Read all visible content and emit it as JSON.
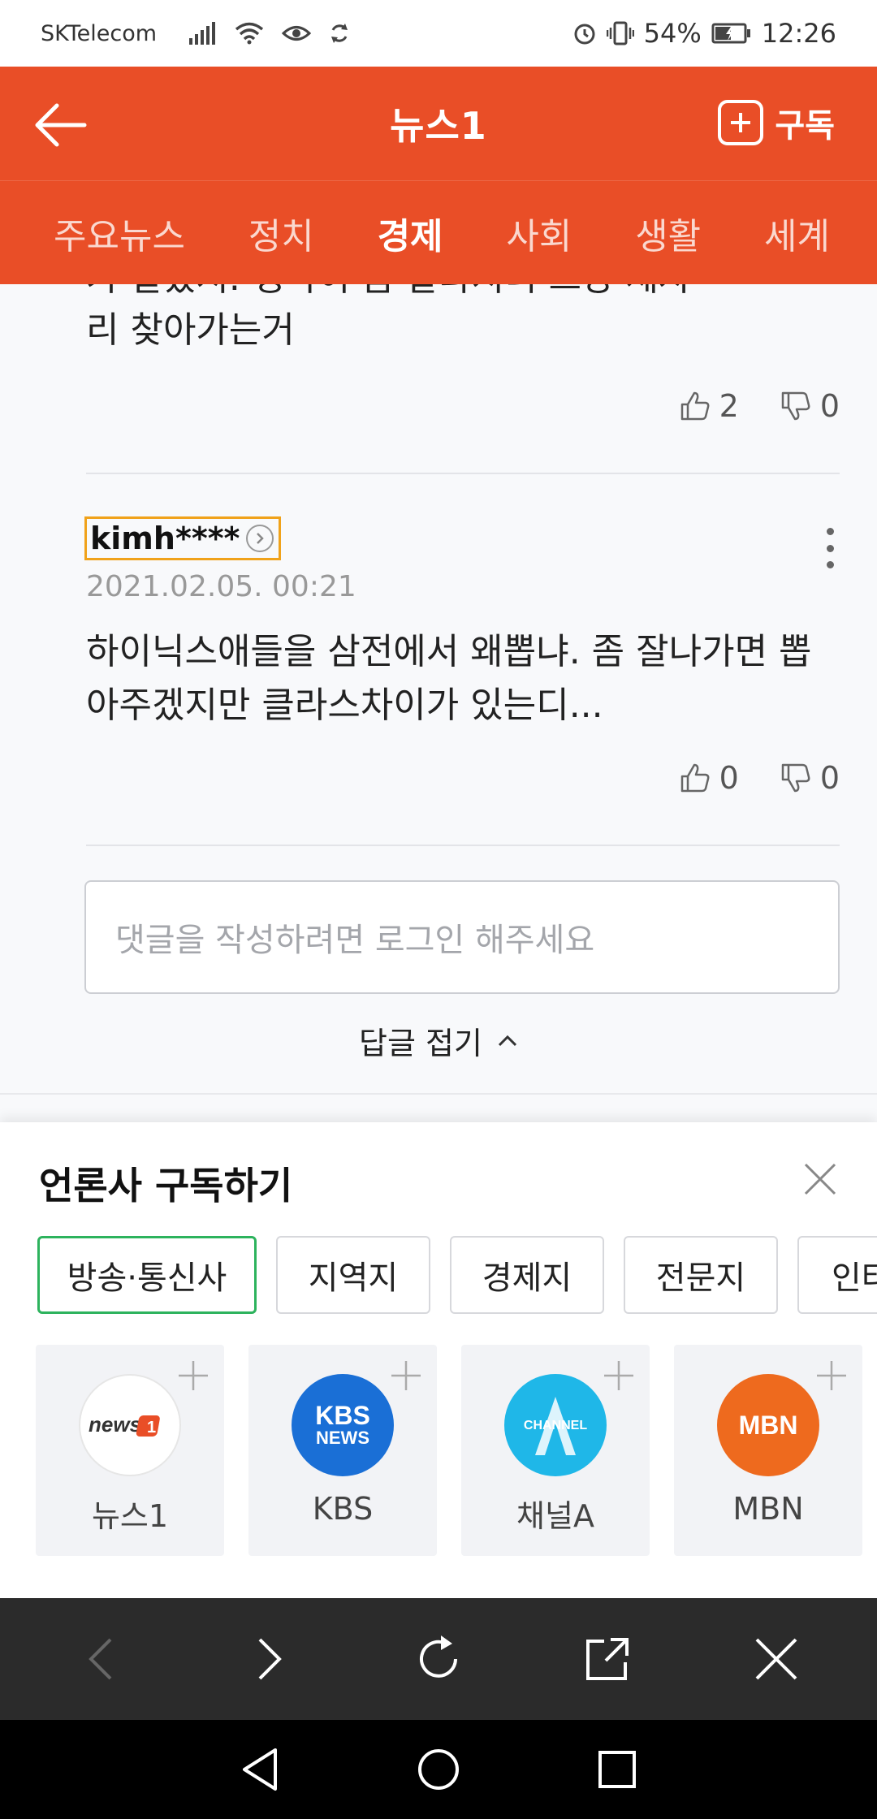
{
  "status_bar": {
    "carrier": "SKTelecom",
    "battery": "54%",
    "time": "12:26"
  },
  "header": {
    "title": "뉴스1",
    "subscribe_label": "구독"
  },
  "tabs": [
    {
      "label": "주요뉴스",
      "active": false
    },
    {
      "label": "정치",
      "active": false
    },
    {
      "label": "경제",
      "active": true
    },
    {
      "label": "사회",
      "active": false
    },
    {
      "label": "생활",
      "active": false
    },
    {
      "label": "세계",
      "active": false
    }
  ],
  "comments": [
    {
      "partial_line": "가 알았지. 생각이 좀 달라지니 그냥 제자",
      "text": "리 찾아가는거",
      "likes": "2",
      "dislikes": "0"
    },
    {
      "author": "kimh****",
      "date": "2021.02.05. 00:21",
      "text": "하이닉스애들을 삼전에서 왜뽑냐. 좀 잘나가면 뽑아주겠지만 클라스차이가 있는디...",
      "likes": "0",
      "dislikes": "0"
    }
  ],
  "comment_input": {
    "placeholder": "댓글을 작성하려면 로그인 해주세요"
  },
  "fold_label": "답글 접기",
  "subscribe_sheet": {
    "title": "언론사 구독하기",
    "categories": [
      {
        "label": "방송·통신사",
        "active": true
      },
      {
        "label": "지역지",
        "active": false
      },
      {
        "label": "경제지",
        "active": false
      },
      {
        "label": "전문지",
        "active": false
      },
      {
        "label": "인터",
        "active": false
      }
    ],
    "press": [
      {
        "name": "뉴스1",
        "logo_text": "news1",
        "logo_bg": "#ffffff",
        "logo_fg": "#e94e27"
      },
      {
        "name": "KBS",
        "logo_text": "KBS NEWS",
        "logo_bg": "#1a6fd6",
        "logo_fg": "#ffffff"
      },
      {
        "name": "채널A",
        "logo_text": "CHANNEL A",
        "logo_bg": "#1fb7e8",
        "logo_fg": "#ffffff"
      },
      {
        "name": "MBN",
        "logo_text": "MBN",
        "logo_bg": "#ee6a1e",
        "logo_fg": "#ffffff"
      }
    ]
  },
  "colors": {
    "brand": "#e94e27",
    "chip_active": "#2db35d",
    "author_highlight": "#f0a21a"
  }
}
